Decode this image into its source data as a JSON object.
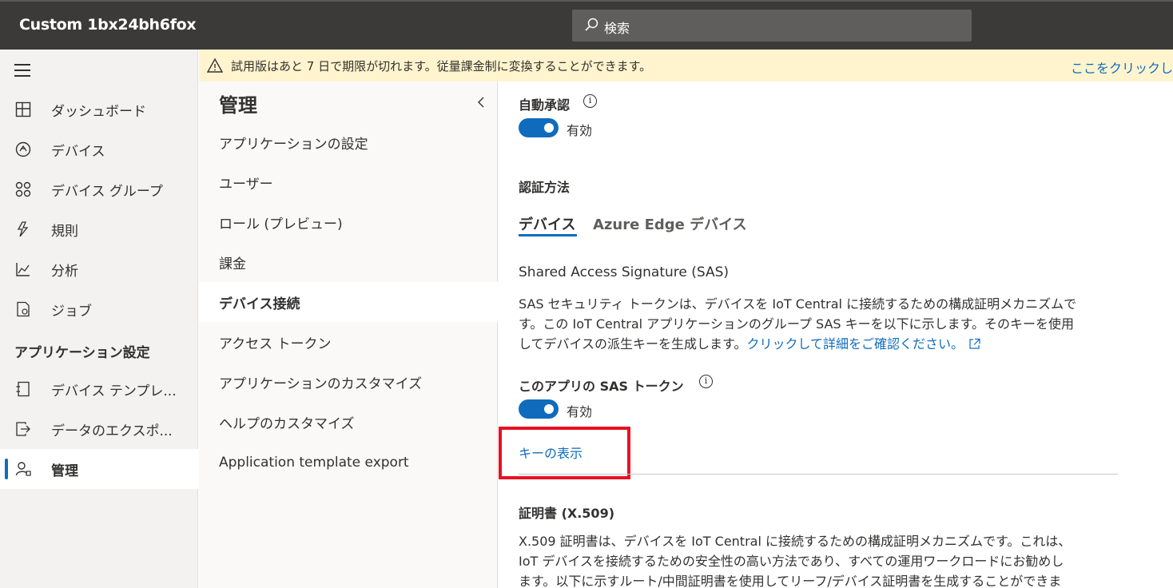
{
  "header": {
    "app_title": "Custom 1bx24bh6fox",
    "search_placeholder": "検索"
  },
  "banner": {
    "message": "試用版はあと 7 日で期限が切れます。従量課金制に変換することができます。",
    "link": "ここをクリックし"
  },
  "leftnav": {
    "items": [
      {
        "label": "ダッシュボード",
        "icon": "dashboard-icon"
      },
      {
        "label": "デバイス",
        "icon": "devices-icon"
      },
      {
        "label": "デバイス グループ",
        "icon": "device-groups-icon"
      },
      {
        "label": "規則",
        "icon": "rules-icon"
      },
      {
        "label": "分析",
        "icon": "analytics-icon"
      },
      {
        "label": "ジョブ",
        "icon": "jobs-icon"
      }
    ],
    "section_title": "アプリケーション設定",
    "settings_items": [
      {
        "label": "デバイス テンプレ...",
        "icon": "device-templates-icon"
      },
      {
        "label": "データのエクスポ...",
        "icon": "data-export-icon"
      },
      {
        "label": "管理",
        "icon": "administration-icon",
        "active": true
      }
    ]
  },
  "subnav": {
    "title": "管理",
    "items": [
      "アプリケーションの設定",
      "ユーザー",
      "ロール (プレビュー)",
      "課金",
      "デバイス接続",
      "アクセス トークン",
      "アプリケーションのカスタマイズ",
      "ヘルプのカスタマイズ",
      "Application template export"
    ],
    "active_index": 4
  },
  "content": {
    "auto_approve": {
      "label": "自動承認",
      "toggle_text": "有効",
      "enabled": true
    },
    "auth_method": {
      "label": "認証方法"
    },
    "tabs": [
      "デバイス",
      "Azure Edge デバイス"
    ],
    "active_tab": 0,
    "sas": {
      "heading": "Shared Access Signature (SAS)",
      "description_1": "SAS セキュリティ トークンは、デバイスを IoT Central に接続するための構成証明メカニズムで",
      "description_2": "す。この IoT Central アプリケーションのグループ SAS キーを以下に示します。そのキーを使用",
      "description_3": "してデバイスの派生キーを生成します。",
      "link": "クリックして詳細をご確認ください。",
      "token_label": "このアプリの SAS トークン",
      "token_toggle_text": "有効",
      "token_enabled": true,
      "show_key": "キーの表示"
    },
    "certificate": {
      "heading": "証明書 (X.509)",
      "description_1": "X.509 証明書は、デバイスを IoT Central に接続するための構成証明メカニズムです。これは、",
      "description_2": "IoT デバイスを接続するための安全性の高い方法であり、すべての運用ワークロードにお勧めし",
      "description_3": "ます。以下に示すルート/中間証明書を使用してリーフ/デバイス証明書を生成することができま"
    }
  },
  "colors": {
    "accent": "#0f6cbd",
    "highlight": "#e81123",
    "banner": "#fff4ce",
    "header": "#3b3a39"
  }
}
